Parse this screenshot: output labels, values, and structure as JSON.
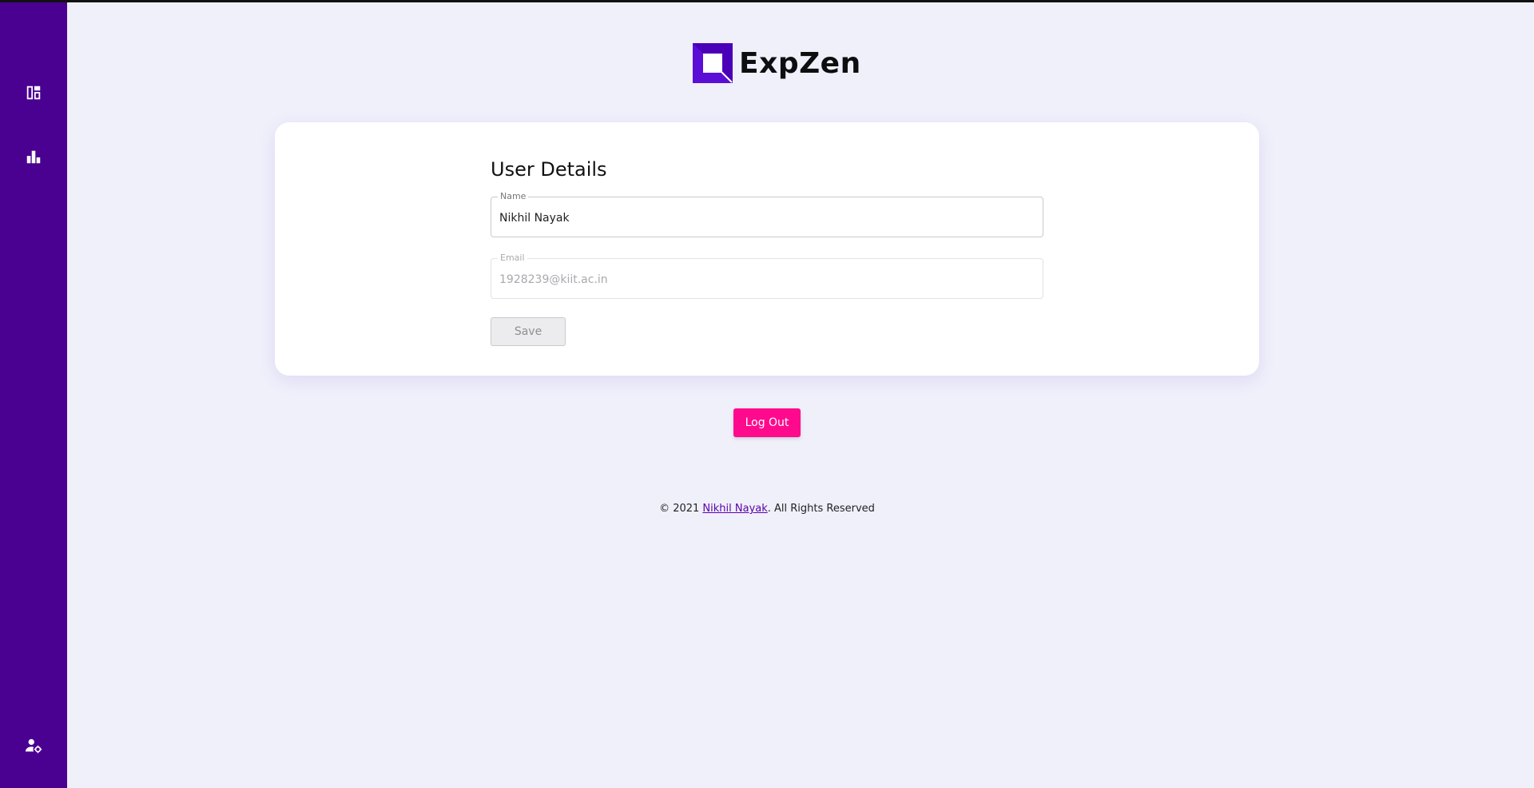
{
  "app": {
    "name": "ExpZen"
  },
  "sidebar": {
    "items": [
      {
        "icon": "dashboard-icon"
      },
      {
        "icon": "bar-chart-icon"
      },
      {
        "icon": "user-settings-icon"
      }
    ]
  },
  "card": {
    "title": "User Details",
    "name_field": {
      "label": "Name",
      "value": "Nikhil Nayak"
    },
    "email_field": {
      "label": "Email",
      "value": "1928239@kiit.ac.in"
    },
    "save_label": "Save"
  },
  "logout_label": "Log Out",
  "footer": {
    "prefix": "© 2021 ",
    "author": "Nikhil Nayak",
    "suffix": ". All Rights Reserved"
  },
  "colors": {
    "sidebar": "#4a0091",
    "background": "#f0f0fb",
    "logout": "#ff0a8d",
    "link": "#5b00a8"
  }
}
